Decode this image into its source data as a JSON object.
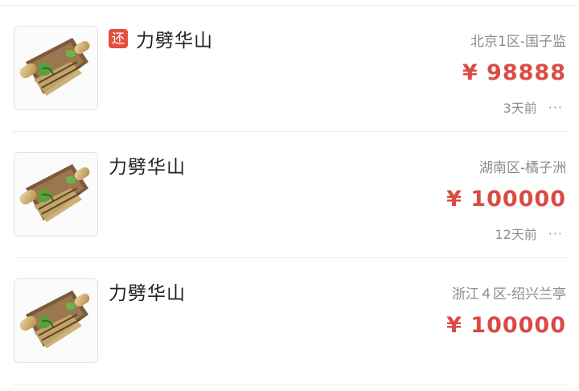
{
  "listings": [
    {
      "title": "力劈华山",
      "badge": "还",
      "server": "北京1区-国子监",
      "price": "¥ 98888",
      "time": "3天前",
      "more": "···"
    },
    {
      "title": "力劈华山",
      "server": "湖南区-橘子洲",
      "price": "¥ 100000",
      "time": "12天前",
      "more": "···"
    },
    {
      "title": "力劈华山",
      "server": "浙江４区-绍兴兰亭",
      "price": "¥ 100000"
    }
  ],
  "colors": {
    "price": "#d94b44",
    "badge": "#e2503f",
    "divider": "#ececec"
  },
  "icons": {
    "thumbnail": "skill-scroll-icon",
    "badge": "return-badge-icon",
    "more": "more-dots-icon"
  }
}
